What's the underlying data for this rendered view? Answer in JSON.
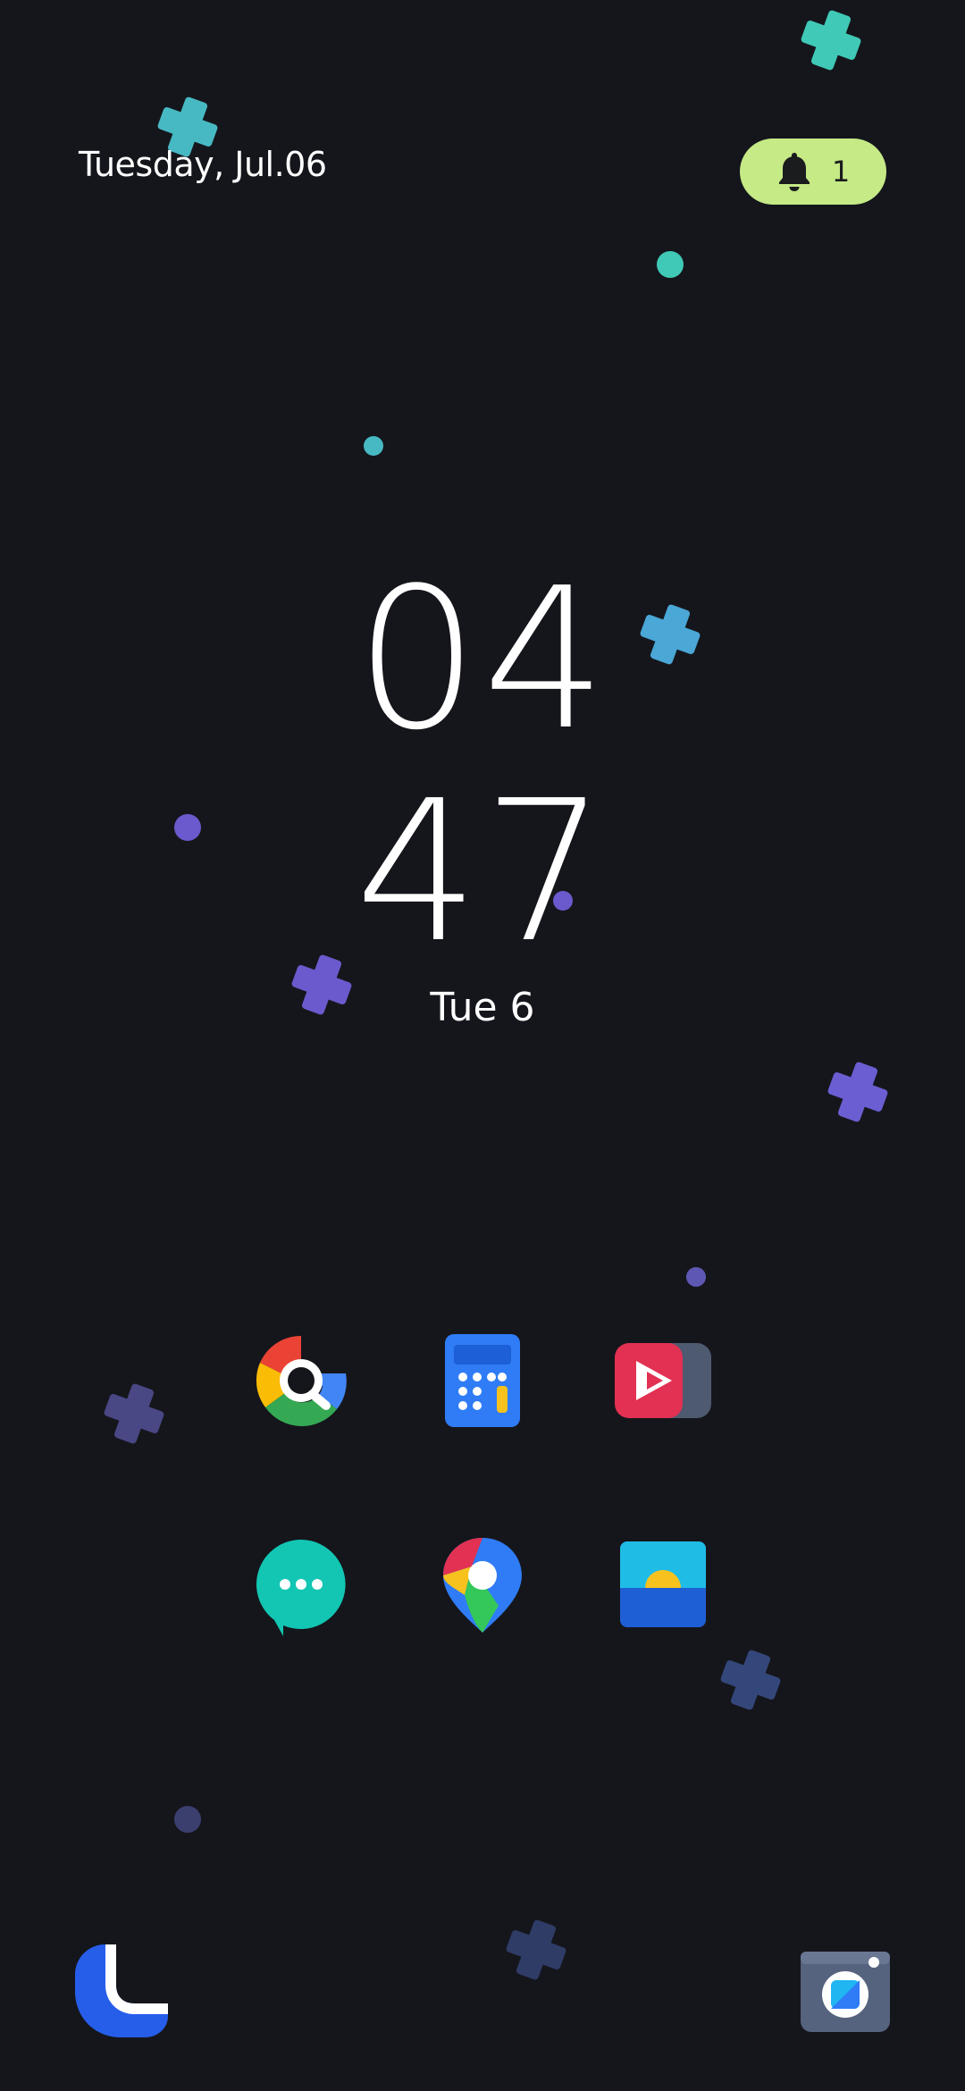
{
  "status": {
    "date_text": "Tuesday, Jul.06",
    "notification_count": "1",
    "pill_color": "#c5ea86"
  },
  "clock": {
    "hours": "04",
    "minutes": "47",
    "date_short": "Tue 6"
  },
  "home_apps": [
    {
      "icon": "search-app-icon"
    },
    {
      "icon": "calculator-icon"
    },
    {
      "icon": "video-player-icon"
    },
    {
      "icon": "messages-icon"
    },
    {
      "icon": "maps-icon"
    },
    {
      "icon": "gallery-icon"
    }
  ],
  "dock": [
    {
      "icon": "phone-icon"
    },
    {
      "icon": "camera-icon"
    }
  ],
  "colors": {
    "background": "#15161c",
    "teal": "#3fc9b6",
    "purple": "#6a5acd",
    "slate": "#3c4a78"
  }
}
